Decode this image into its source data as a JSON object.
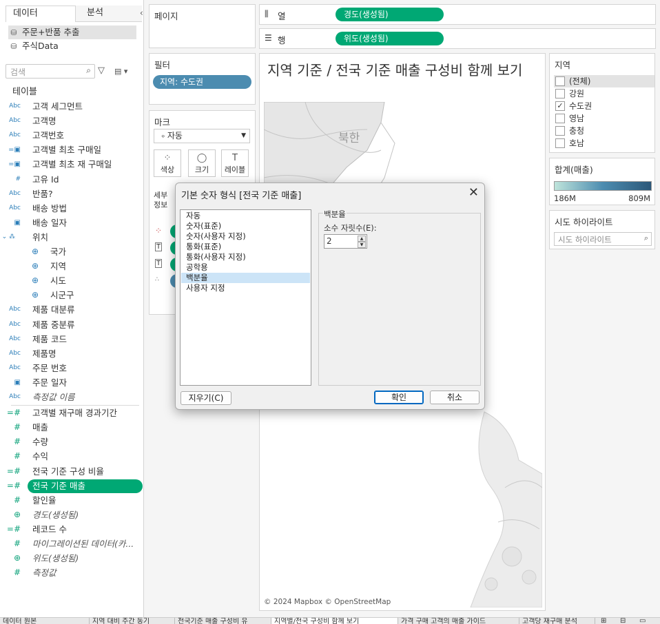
{
  "left_pane": {
    "tabs": [
      "데이터",
      "분석"
    ],
    "datasources": [
      "주문+반품 추출",
      "주식Data"
    ],
    "search_placeholder": "검색",
    "section_title": "테이블",
    "dimensions": [
      {
        "icon": "Abc",
        "label": "고객 세그먼트"
      },
      {
        "icon": "Abc",
        "label": "고객명"
      },
      {
        "icon": "Abc",
        "label": "고객번호"
      },
      {
        "icon": "date-calc",
        "label": "고객별 최초 구매일"
      },
      {
        "icon": "date-calc",
        "label": "고객별 최초 재 구매일"
      },
      {
        "icon": "#",
        "label": "고유 Id"
      },
      {
        "icon": "Abc",
        "label": "반품?"
      },
      {
        "icon": "Abc",
        "label": "배송 방법"
      },
      {
        "icon": "date",
        "label": "배송 일자"
      },
      {
        "icon": "hierarchy",
        "label": "위치"
      },
      {
        "icon": "geo",
        "label": "국가"
      },
      {
        "icon": "geo",
        "label": "지역"
      },
      {
        "icon": "geo",
        "label": "시도"
      },
      {
        "icon": "geo",
        "label": "시군구"
      },
      {
        "icon": "Abc",
        "label": "제품 대분류"
      },
      {
        "icon": "Abc",
        "label": "제품 중분류"
      },
      {
        "icon": "Abc",
        "label": "제품 코드"
      },
      {
        "icon": "Abc",
        "label": "제품명"
      },
      {
        "icon": "Abc",
        "label": "주문 번호"
      },
      {
        "icon": "date",
        "label": "주문 일자"
      },
      {
        "icon": "Abc",
        "label": "측정값 이름"
      }
    ],
    "measures": [
      {
        "icon": "=#",
        "label": "고객별 재구매 경과기간"
      },
      {
        "icon": "#",
        "label": "매출"
      },
      {
        "icon": "#",
        "label": "수량"
      },
      {
        "icon": "#",
        "label": "수익"
      },
      {
        "icon": "=#",
        "label": "전국 기준 구성 비율"
      },
      {
        "icon": "=#",
        "label": "전국 기준 매출"
      },
      {
        "icon": "#",
        "label": "할인율"
      },
      {
        "icon": "geo",
        "label": "경도(생성됨)"
      },
      {
        "icon": "=#",
        "label": "레코드 수"
      },
      {
        "icon": "#",
        "label": "마이그레이션된 데이터(카..."
      },
      {
        "icon": "geo",
        "label": "위도(생성됨)"
      },
      {
        "icon": "#",
        "label": "측정값"
      }
    ]
  },
  "shelves": {
    "pages_title": "페이지",
    "filters_title": "필터",
    "filter_pill": "지역: 수도권",
    "marks_title": "마크",
    "mark_type": "자동",
    "mark_buttons": [
      "색상",
      "크기",
      "레이블"
    ],
    "mark_row2_partial": [
      "세부",
      "정보"
    ],
    "columns_label": "열",
    "columns_pill": "경도(생성됨)",
    "rows_label": "행",
    "rows_pill": "위도(생성됨)"
  },
  "view": {
    "title": "지역 기준 / 전국 기준 매출 구성비 함께 보기",
    "map_label": "북한",
    "attribution": "© 2024 Mapbox © OpenStreetMap"
  },
  "legends": {
    "region_title": "지역",
    "region_items": [
      {
        "label": "(전체)",
        "checked": false
      },
      {
        "label": "강원",
        "checked": false
      },
      {
        "label": "수도권",
        "checked": true
      },
      {
        "label": "영남",
        "checked": false
      },
      {
        "label": "충청",
        "checked": false
      },
      {
        "label": "호남",
        "checked": false
      }
    ],
    "sum_title": "합계(매출)",
    "sum_min": "186M",
    "sum_max": "809M",
    "highlight_title": "시도 하이라이트",
    "highlight_placeholder": "시도 하이라이트"
  },
  "dialog": {
    "title": "기본 숫자 형식 [전국 기준 매출]",
    "options": [
      "자동",
      "숫자(표준)",
      "숫자(사용자 지정)",
      "통화(표준)",
      "통화(사용자 지정)",
      "공학용",
      "백분율",
      "사용자 지정"
    ],
    "selected_option": "백분율",
    "group_label": "백분율",
    "decimal_label": "소수 자릿수(E):",
    "decimal_value": "2",
    "clear_button": "지우기(C)",
    "ok_button": "확인",
    "cancel_button": "취소"
  },
  "bottom_tabs": [
    "데이터 원본",
    "지역 대비 주간 동기",
    "전국기준 매출 구성비 유",
    "지역별/전국 구성비 함께 보기",
    "가격 구매 고객의 매출 가이드",
    "고객당 재구매 분석"
  ]
}
